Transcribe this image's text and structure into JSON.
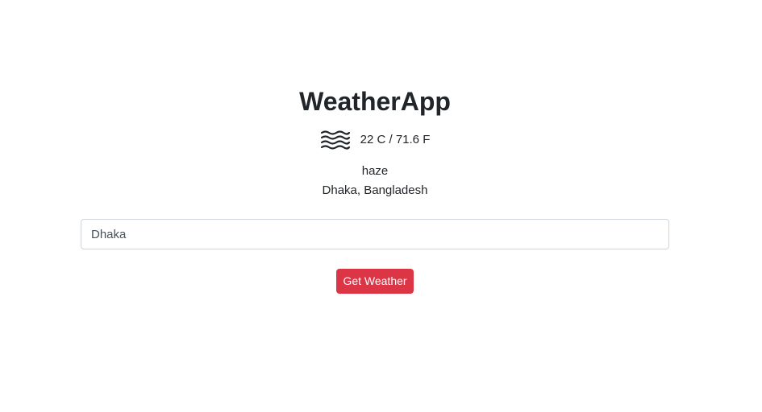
{
  "app": {
    "title": "WeatherApp"
  },
  "weather": {
    "icon": "haze-icon",
    "temperature": "22 C / 71.6 F",
    "description": "haze",
    "location": "Dhaka, Bangladesh"
  },
  "search": {
    "value": "Dhaka"
  },
  "actions": {
    "get_weather_label": "Get Weather",
    "button_color": "#dc3545"
  }
}
